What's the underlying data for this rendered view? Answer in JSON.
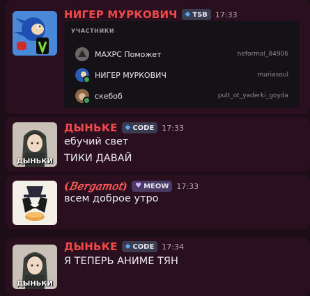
{
  "messages": [
    {
      "username": "НИГЕР МУРКОВИЧ",
      "tag_icon": "flame-icon",
      "tag": "TSB",
      "time": "17:33",
      "embed": {
        "title": "УЧАСТНИКИ",
        "members": [
          {
            "name": "МАХРС Поможет",
            "handle": "neformal_84906"
          },
          {
            "name": "НИГЕР МУРКОВИЧ",
            "handle": "muriasoul"
          },
          {
            "name": "скебоб",
            "handle": "pult_ot_yaderki_goyda"
          }
        ]
      }
    },
    {
      "username": "ДЫНЬКЕ",
      "tag_icon": "flame-icon",
      "tag": "CODE",
      "time": "17:33",
      "avatar_text": "ДЫНЬКИ",
      "lines": [
        "ебучий свет",
        "ТИКИ ДАВАЙ"
      ]
    },
    {
      "username": "(𝐵𝑒𝑟𝑔𝑎𝑚𝑜𝑡)",
      "tag_icon": "heart-icon",
      "tag": "MEOW",
      "time": "17:33",
      "lines": [
        "всем доброе утро"
      ]
    },
    {
      "username": "ДЫНЬКЕ",
      "tag_icon": "flame-icon",
      "tag": "CODE",
      "time": "17:34",
      "avatar_text": "ДЫНЬКИ",
      "lines": [
        "Я ТЕПЕРЬ АНИМЕ ТЯН"
      ]
    }
  ],
  "colors": {
    "background": "#1d0d17",
    "message_bg": "#2a0f1f",
    "username": "#f04a4a",
    "online": "#3ba55c"
  }
}
